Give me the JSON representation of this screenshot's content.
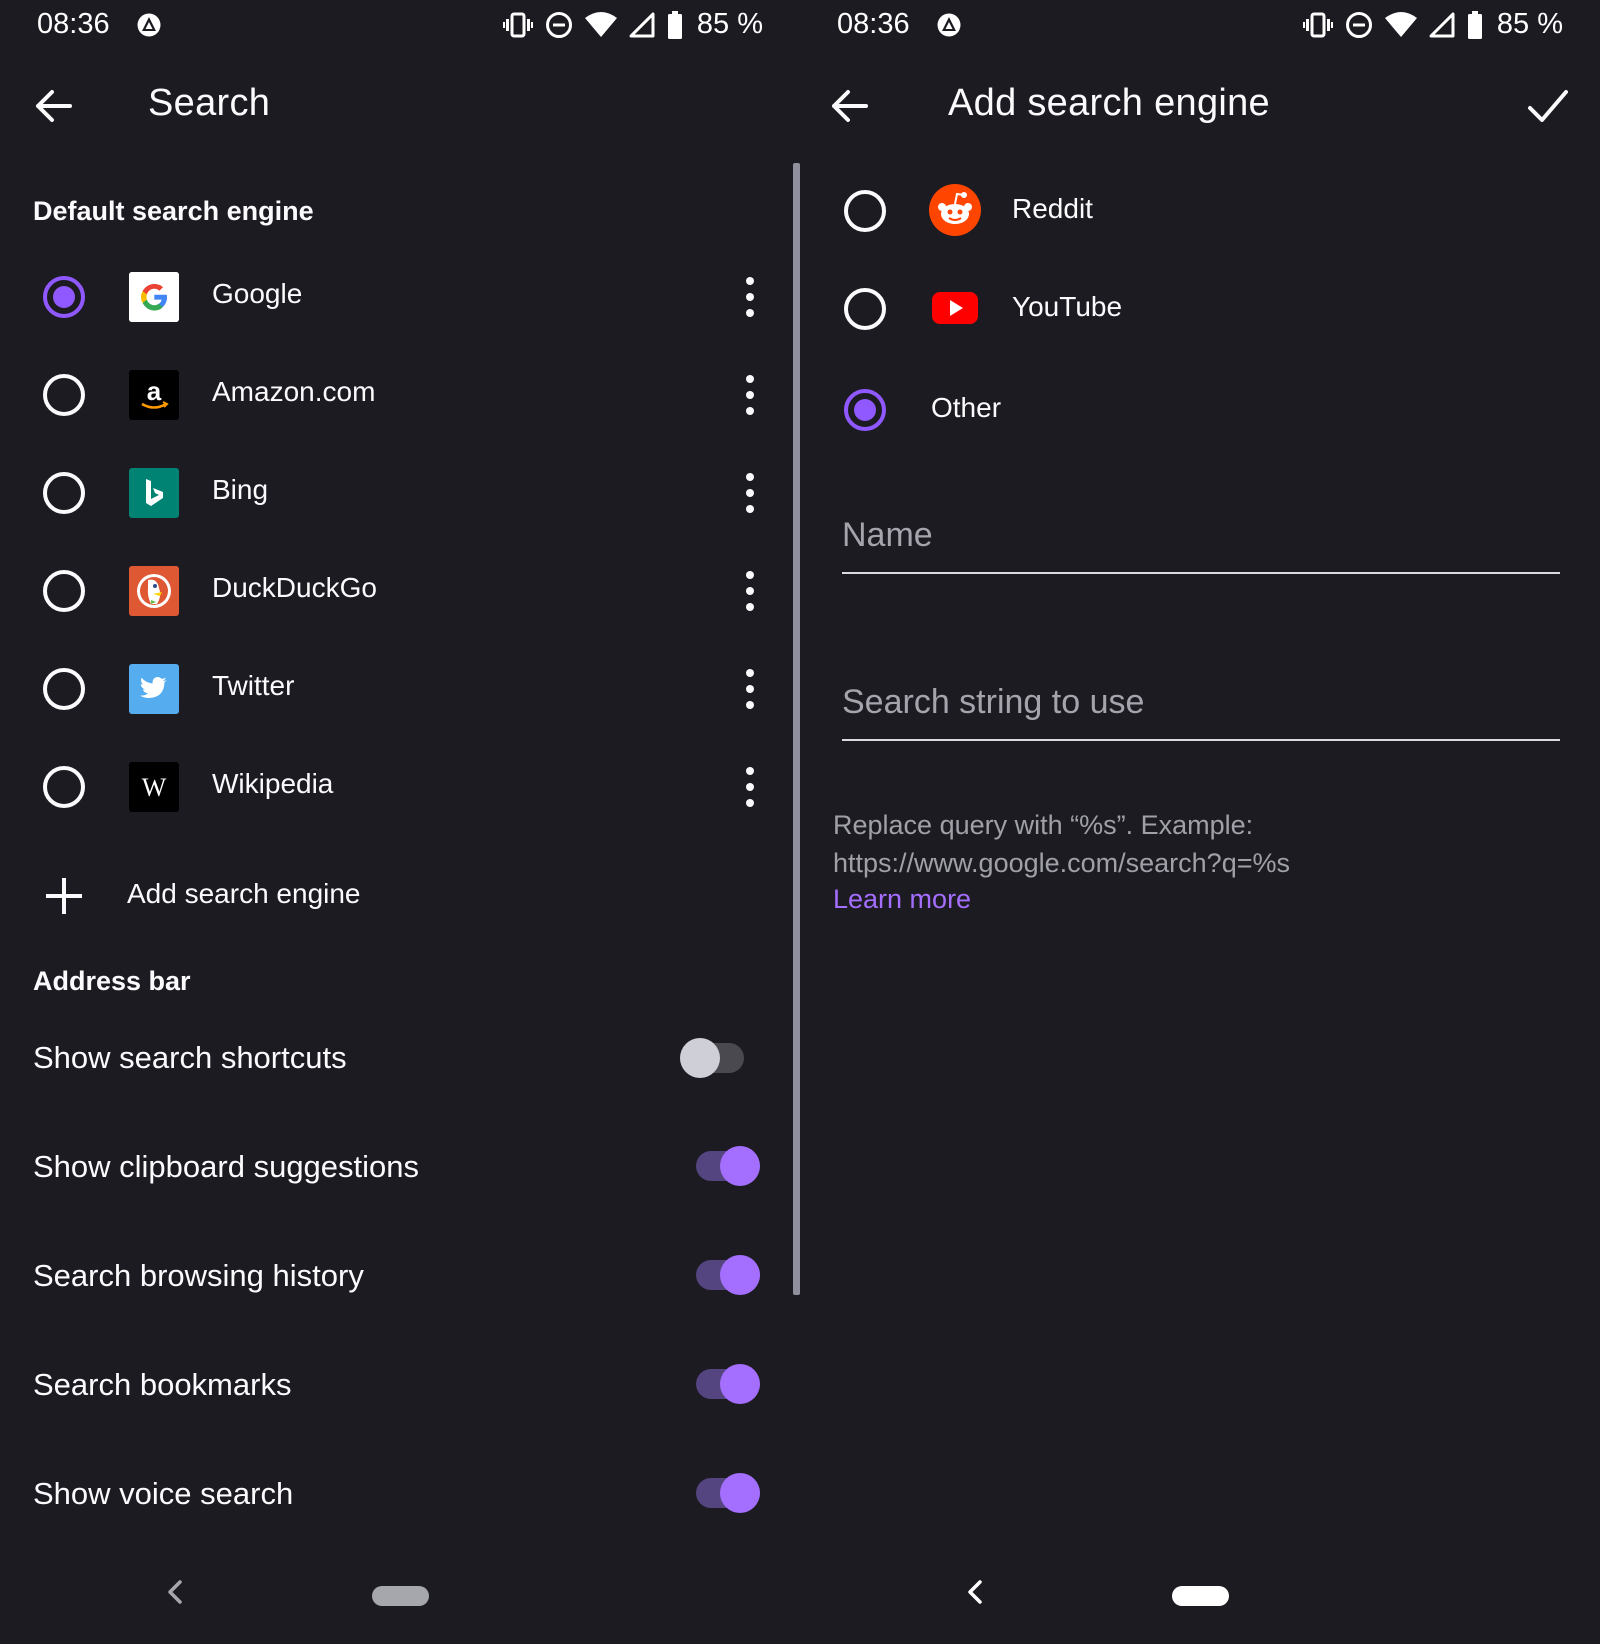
{
  "colors": {
    "background": "#1c1b22",
    "text": "#fbfbfe",
    "accent": "#9059ff",
    "accent_thumb": "#a46eff",
    "muted": "#a0a0a8"
  },
  "status_bar": {
    "time": "08:36",
    "battery": "85 %",
    "icons": [
      "vibrate-icon",
      "do-not-disturb-icon",
      "wifi-icon",
      "cell-signal-icon",
      "battery-icon"
    ]
  },
  "left": {
    "title": "Search",
    "default_engine_header": "Default search engine",
    "engines": [
      {
        "label": "Google",
        "icon": "google-icon",
        "selected": true
      },
      {
        "label": "Amazon.com",
        "icon": "amazon-icon",
        "selected": false
      },
      {
        "label": "Bing",
        "icon": "bing-icon",
        "selected": false
      },
      {
        "label": "DuckDuckGo",
        "icon": "duckduckgo-icon",
        "selected": false
      },
      {
        "label": "Twitter",
        "icon": "twitter-icon",
        "selected": false
      },
      {
        "label": "Wikipedia",
        "icon": "wikipedia-icon",
        "selected": false
      }
    ],
    "add_engine_label": "Add search engine",
    "address_bar_header": "Address bar",
    "prefs": [
      {
        "label": "Show search shortcuts",
        "on": false
      },
      {
        "label": "Show clipboard suggestions",
        "on": true
      },
      {
        "label": "Search browsing history",
        "on": true
      },
      {
        "label": "Search bookmarks",
        "on": true
      },
      {
        "label": "Show voice search",
        "on": true
      }
    ]
  },
  "right": {
    "title": "Add search engine",
    "choices": [
      {
        "label": "Reddit",
        "icon": "reddit-icon",
        "selected": false
      },
      {
        "label": "YouTube",
        "icon": "youtube-icon",
        "selected": false
      },
      {
        "label": "Other",
        "icon": "",
        "selected": true
      }
    ],
    "name_placeholder": "Name",
    "search_string_placeholder": "Search string to use",
    "helper_line1": "Replace query with “%s”. Example:",
    "helper_line2": "https://www.google.com/search?q=%s",
    "learn_more": "Learn more"
  }
}
